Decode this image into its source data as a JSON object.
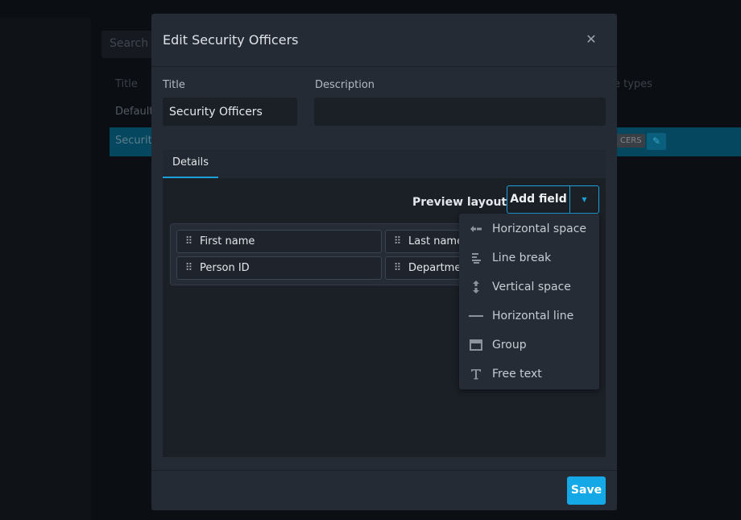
{
  "background": {
    "search_placeholder": "Search",
    "columns": {
      "title": "Title",
      "types": "e types"
    },
    "rows": [
      {
        "title": "Default"
      },
      {
        "title": "Security",
        "badge": "CERS"
      }
    ]
  },
  "modal": {
    "title": "Edit Security Officers",
    "fields": {
      "title_label": "Title",
      "title_value": "Security Officers",
      "description_label": "Description",
      "description_value": ""
    },
    "tabs": [
      {
        "label": "Details",
        "active": true
      }
    ],
    "toolbar": {
      "preview_label": "Preview layout",
      "add_field_label": "Add field"
    },
    "layout_fields": [
      {
        "label": "First name"
      },
      {
        "label": "Last name"
      },
      {
        "label": "Person ID"
      },
      {
        "label": "Department"
      }
    ],
    "dropdown": {
      "items": [
        {
          "label": "Horizontal space",
          "icon": "horizontal-space-icon"
        },
        {
          "label": "Line break",
          "icon": "line-break-icon"
        },
        {
          "label": "Vertical space",
          "icon": "vertical-space-icon"
        },
        {
          "label": "Horizontal line",
          "icon": "horizontal-line-icon"
        },
        {
          "label": "Group",
          "icon": "group-icon"
        },
        {
          "label": "Free text",
          "icon": "free-text-icon"
        }
      ]
    },
    "footer": {
      "save_label": "Save"
    }
  },
  "colors": {
    "accent": "#1ba1d8",
    "save_button": "#15a8e6",
    "modal_bg": "#252b35",
    "selected_row": "#064760"
  }
}
